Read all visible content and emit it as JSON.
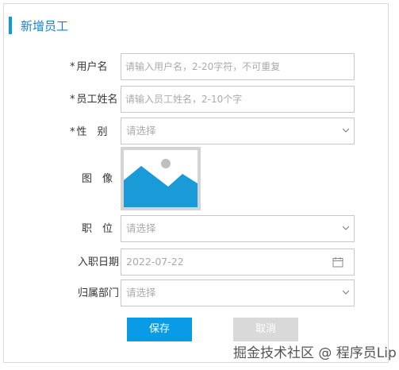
{
  "form": {
    "title": "新增员工",
    "username": {
      "required_mark": "*",
      "label": "用户名",
      "placeholder": "请输入用户名，2-20字符，不可重复"
    },
    "fullname": {
      "required_mark": "*",
      "label": "员工姓名",
      "placeholder": "请输入员工姓名，2-10个字"
    },
    "gender": {
      "required_mark": "*",
      "label": "性　别",
      "placeholder": "请选择"
    },
    "avatar": {
      "label": "图　像"
    },
    "position": {
      "label": "职　位",
      "placeholder": "请选择"
    },
    "hire_date": {
      "label": "入职日期",
      "value": "2022-07-22"
    },
    "department": {
      "label": "归属部门",
      "placeholder": "请选择"
    }
  },
  "buttons": {
    "save": "保存",
    "cancel": "取消"
  },
  "watermark": "掘金技术社区 @ 程序员Lip",
  "icons": {
    "chevron": "chevron-down-icon",
    "calendar": "calendar-icon",
    "image_placeholder": "image-placeholder-icon"
  },
  "colors": {
    "accent": "#0a9be6",
    "title": "#1a7fcf",
    "cancel_bg": "#d9d9d9"
  }
}
